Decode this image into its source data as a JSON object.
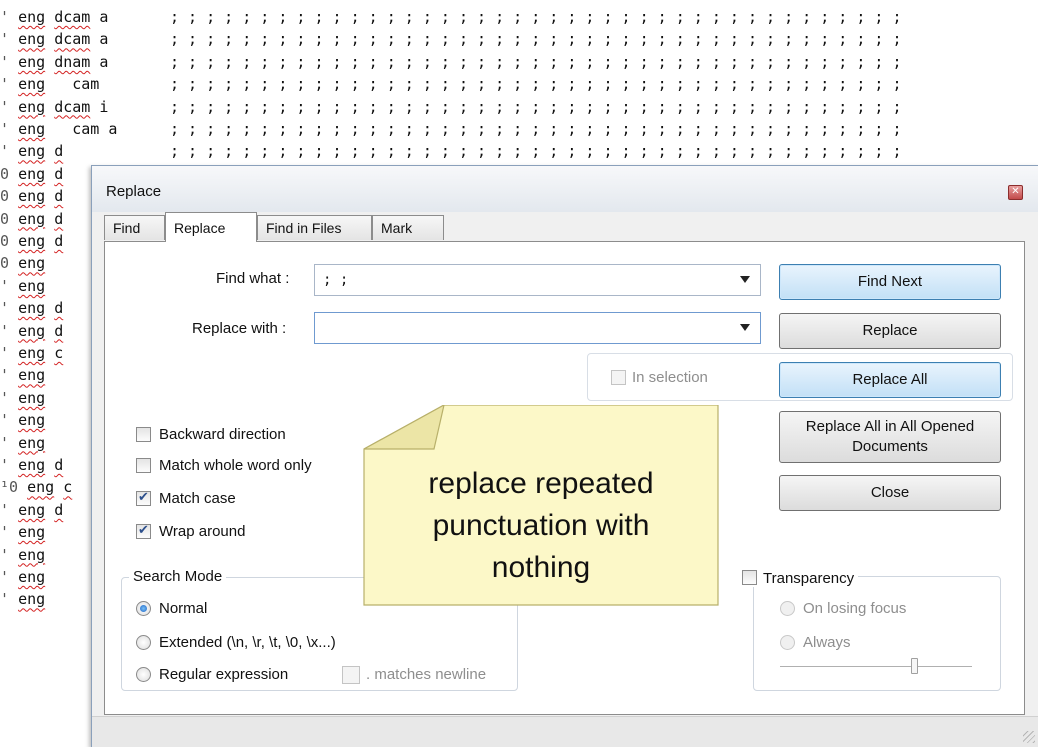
{
  "editor": {
    "top_fragment": "~~~~ ~~~~~~~",
    "semicolons": "; ; ; ; ; ; ; ; ; ; ; ; ; ; ; ; ; ; ; ; ; ; ; ; ; ; ; ; ; ; ; ; ; ; ; ; ; ; ; ; ;",
    "lines": [
      {
        "prefix": "",
        "tick": "'",
        "word1": "eng",
        "word2": "dcam",
        "tail": " a"
      },
      {
        "prefix": "",
        "tick": "'",
        "word1": "eng",
        "word2": "dcam",
        "tail": " a"
      },
      {
        "prefix": "",
        "tick": "'",
        "word1": "eng",
        "word2": "dnam",
        "tail": " a"
      },
      {
        "prefix": "",
        "tick": "'",
        "word1": "eng",
        "word2": "",
        "tail": "  cam"
      },
      {
        "prefix": "",
        "tick": "'",
        "word1": "eng",
        "word2": "dcam",
        "tail": " i"
      },
      {
        "prefix": "",
        "tick": "'",
        "word1": "eng",
        "word2": "",
        "tail": "  cam a"
      },
      {
        "prefix": "",
        "tick": "'",
        "word1": "eng",
        "word2": "d",
        "tail": ""
      },
      {
        "prefix": "0",
        "tick": "",
        "word1": "eng",
        "word2": "d",
        "tail": ""
      },
      {
        "prefix": "0",
        "tick": "",
        "word1": "eng",
        "word2": "d",
        "tail": ""
      },
      {
        "prefix": "0",
        "tick": "",
        "word1": "eng",
        "word2": "d",
        "tail": ""
      },
      {
        "prefix": "0",
        "tick": "",
        "word1": "eng",
        "word2": "d",
        "tail": ""
      },
      {
        "prefix": "0",
        "tick": "",
        "word1": "eng",
        "word2": "",
        "tail": ""
      },
      {
        "prefix": "",
        "tick": "'",
        "word1": "eng",
        "word2": "",
        "tail": ""
      },
      {
        "prefix": "",
        "tick": "'",
        "word1": "eng",
        "word2": "d",
        "tail": ""
      },
      {
        "prefix": "",
        "tick": "'",
        "word1": "eng",
        "word2": "d",
        "tail": ""
      },
      {
        "prefix": "",
        "tick": "'",
        "word1": "eng",
        "word2": "c",
        "tail": ""
      },
      {
        "prefix": "",
        "tick": "'",
        "word1": "eng",
        "word2": "",
        "tail": ""
      },
      {
        "prefix": "",
        "tick": "'",
        "word1": "eng",
        "word2": "",
        "tail": ""
      },
      {
        "prefix": "",
        "tick": "'",
        "word1": "eng",
        "word2": "",
        "tail": ""
      },
      {
        "prefix": "",
        "tick": "'",
        "word1": "eng",
        "word2": "",
        "tail": ""
      },
      {
        "prefix": "",
        "tick": "'",
        "word1": "eng",
        "word2": "d",
        "tail": ""
      },
      {
        "prefix": "¹0",
        "tick": "",
        "word1": "eng",
        "word2": "c",
        "tail": ""
      },
      {
        "prefix": "",
        "tick": "'",
        "word1": "eng",
        "word2": "d",
        "tail": ""
      },
      {
        "prefix": "",
        "tick": "'",
        "word1": "eng",
        "word2": "",
        "tail": ""
      },
      {
        "prefix": "",
        "tick": "'",
        "word1": "eng",
        "word2": "",
        "tail": ""
      },
      {
        "prefix": "",
        "tick": "'",
        "word1": "eng",
        "word2": "",
        "tail": ""
      },
      {
        "prefix": "",
        "tick": "'",
        "word1": "eng",
        "word2": "",
        "tail": ""
      }
    ]
  },
  "dialog": {
    "title": "Replace",
    "close_glyph": "✕",
    "tabs": [
      "Find",
      "Replace",
      "Find in Files",
      "Mark"
    ],
    "active_tab": "Replace",
    "find_what_label": "Find what :",
    "find_what_value": "; ;",
    "replace_with_label": "Replace with :",
    "replace_with_value": "",
    "buttons": {
      "find_next": "Find Next",
      "replace": "Replace",
      "replace_all": "Replace All",
      "replace_all_opened": "Replace All in All Opened Documents",
      "close": "Close"
    },
    "in_selection": {
      "label": "In selection",
      "checked": false,
      "enabled": false
    },
    "options": [
      {
        "label": "Backward direction",
        "checked": false
      },
      {
        "label": "Match whole word only",
        "checked": false
      },
      {
        "label": "Match case",
        "checked": true
      },
      {
        "label": "Wrap around",
        "checked": true
      }
    ],
    "search_mode": {
      "title": "Search Mode",
      "options": [
        "Normal",
        "Extended (\\n, \\r, \\t, \\0, \\x...)",
        "Regular expression"
      ],
      "selected": "Normal",
      "matches_newline": {
        "label": ". matches newline",
        "checked": false,
        "enabled": false
      }
    },
    "transparency": {
      "label": "Transparency",
      "checked": false,
      "options": [
        "On losing focus",
        "Always"
      ],
      "slider_level": 0.7
    }
  },
  "callout": {
    "text_lines": [
      "replace repeated",
      "punctuation with",
      "nothing"
    ],
    "fill_color": "#fcf8c8",
    "border_color": "#b8b06a"
  }
}
